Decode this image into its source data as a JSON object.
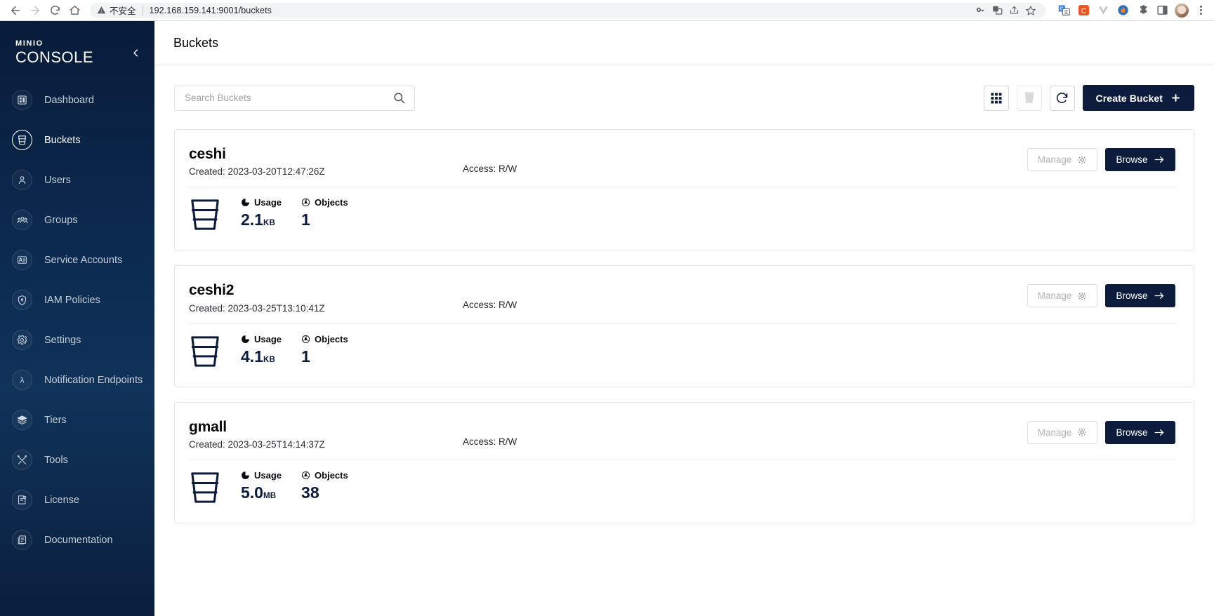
{
  "browser": {
    "back_icon": "back-arrow-icon",
    "forward_icon": "forward-arrow-icon",
    "reload_icon": "reload-icon",
    "home_icon": "home-icon",
    "security_label": "不安全",
    "url": "192.168.159.141:9001/buckets",
    "omnibox_icons": [
      "password-key-icon",
      "translate-icon",
      "share-icon",
      "bookmark-star-icon"
    ],
    "extension_icons": [
      "google-translate-extension-icon",
      "c-extension-icon",
      "v-extension-icon",
      "fire-extension-icon",
      "puzzle-extensions-icon",
      "side-panel-icon",
      "profile-avatar-icon",
      "chrome-menu-icon"
    ]
  },
  "sidebar": {
    "logo_top": "MINIO",
    "logo_bottom": "CONSOLE",
    "collapse_icon": "chevron-left-icon",
    "items": [
      {
        "label": "Dashboard",
        "icon": "dashboard-icon",
        "active": false
      },
      {
        "label": "Buckets",
        "icon": "bucket-icon",
        "active": true
      },
      {
        "label": "Users",
        "icon": "user-icon",
        "active": false
      },
      {
        "label": "Groups",
        "icon": "groups-icon",
        "active": false
      },
      {
        "label": "Service Accounts",
        "icon": "service-account-icon",
        "active": false
      },
      {
        "label": "IAM Policies",
        "icon": "shield-lock-icon",
        "active": false
      },
      {
        "label": "Settings",
        "icon": "gear-icon",
        "active": false
      },
      {
        "label": "Notification Endpoints",
        "icon": "lambda-icon",
        "active": false
      },
      {
        "label": "Tiers",
        "icon": "layers-icon",
        "active": false
      },
      {
        "label": "Tools",
        "icon": "tools-icon",
        "active": false
      },
      {
        "label": "License",
        "icon": "license-icon",
        "active": false
      },
      {
        "label": "Documentation",
        "icon": "documentation-icon",
        "active": false
      }
    ]
  },
  "header": {
    "title": "Buckets"
  },
  "toolbar": {
    "search_placeholder": "Search Buckets",
    "search_value": "",
    "search_icon": "search-icon",
    "grid_view_icon": "grid-view-icon",
    "list_view_icon": "bucket-list-view-icon",
    "refresh_icon": "refresh-icon",
    "create_label": "Create Bucket",
    "create_icon": "plus-icon"
  },
  "labels": {
    "created_prefix": "Created:",
    "access_prefix": "Access:",
    "usage_label": "Usage",
    "objects_label": "Objects",
    "usage_icon": "pie-chart-icon",
    "objects_icon": "objects-icon",
    "bucket_glyph_icon": "bucket-icon",
    "manage_label": "Manage",
    "manage_icon": "gear-icon",
    "browse_label": "Browse",
    "browse_icon": "arrow-right-icon"
  },
  "buckets": [
    {
      "name": "ceshi",
      "created": "Created: 2023-03-20T12:47:26Z",
      "access": "Access: R/W",
      "usage_value": "2.1",
      "usage_unit": "KB",
      "objects": "1"
    },
    {
      "name": "ceshi2",
      "created": "Created: 2023-03-25T13:10:41Z",
      "access": "Access: R/W",
      "usage_value": "4.1",
      "usage_unit": "KB",
      "objects": "1"
    },
    {
      "name": "gmall",
      "created": "Created: 2023-03-25T14:14:37Z",
      "access": "Access: R/W",
      "usage_value": "5.0",
      "usage_unit": "MB",
      "objects": "38"
    }
  ],
  "colors": {
    "brand_navy": "#0d1c3d",
    "sidebar_top": "#081c3a",
    "sidebar_mid": "#103359",
    "accent_white": "#ffffff"
  }
}
